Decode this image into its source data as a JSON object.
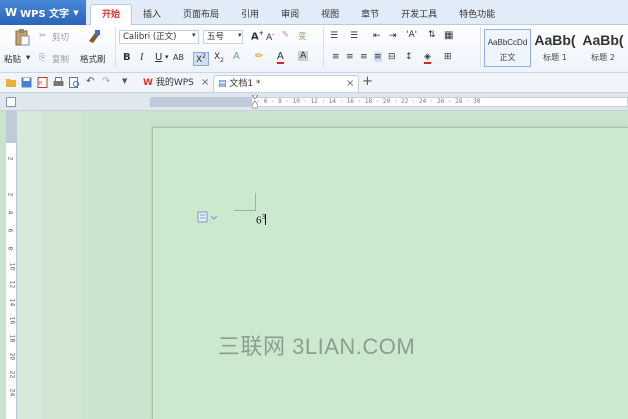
{
  "app": {
    "name": "WPS 文字",
    "logo": "W"
  },
  "tabs": [
    {
      "label": "开始",
      "active": true
    },
    {
      "label": "插入"
    },
    {
      "label": "页面布局"
    },
    {
      "label": "引用"
    },
    {
      "label": "审阅"
    },
    {
      "label": "视图"
    },
    {
      "label": "章节"
    },
    {
      "label": "开发工具"
    },
    {
      "label": "特色功能"
    }
  ],
  "clipboard": {
    "paste": "粘贴",
    "cut": "剪切",
    "copy": "复制",
    "format_painter": "格式刷"
  },
  "font": {
    "family": "Calibri (正文)",
    "size": "五号"
  },
  "styles": [
    {
      "sample": "AaBbCcDd",
      "label": "正文"
    },
    {
      "sample": "AaBb(",
      "label": "标题 1"
    },
    {
      "sample": "AaBb(",
      "label": "标题 2"
    }
  ],
  "doc_tabs": [
    {
      "label": "我的WPS",
      "icon": "wps-icon"
    },
    {
      "label": "文档1 *",
      "icon": "document-icon"
    }
  ],
  "ruler_text": "6 · 4 · 2 · · · 2 · 4 · 6 · 8 · 10 · 12 · 14 · 16 · 18 · 20 · 22 · 24 · 26 · 28 · 30",
  "document": {
    "base": "6",
    "superscript": "3"
  },
  "watermark": "三联网 3LIAN.COM",
  "colors": {
    "accent": "#2a64b8",
    "active_tab_text": "#dd3333",
    "page_bg": "#cce8cf"
  }
}
